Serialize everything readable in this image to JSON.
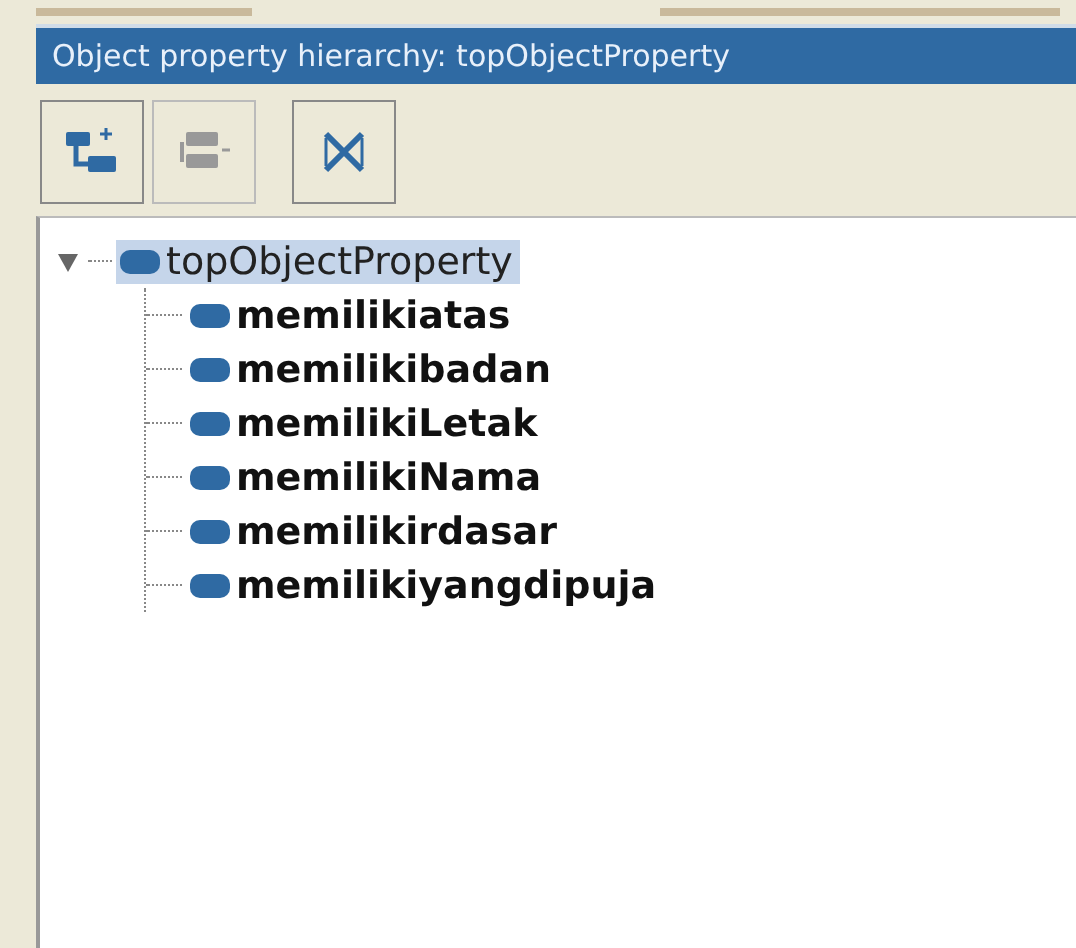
{
  "panel": {
    "title": "Object property hierarchy: topObjectProperty"
  },
  "toolbar": [
    {
      "kind": "add-sub",
      "disabled": false
    },
    {
      "kind": "add-sibling",
      "disabled": true
    },
    {
      "kind": "delete",
      "disabled": false
    }
  ],
  "tree": [
    {
      "label": "topObjectProperty",
      "expanded": true,
      "selected": true,
      "bold": false,
      "children": [
        {
          "label": "memilikiatas",
          "selected": false,
          "bold": true
        },
        {
          "label": "memilikibadan",
          "selected": false,
          "bold": true
        },
        {
          "label": "memilikiLetak",
          "selected": false,
          "bold": true
        },
        {
          "label": "memilikiNama",
          "selected": false,
          "bold": true
        },
        {
          "label": "memilikirdasar",
          "selected": false,
          "bold": true
        },
        {
          "label": "memilikiyangdipuja",
          "selected": false,
          "bold": true
        }
      ]
    }
  ]
}
